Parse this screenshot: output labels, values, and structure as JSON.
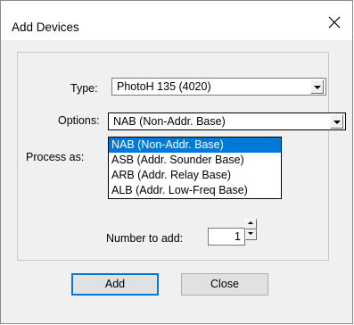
{
  "window": {
    "title": "Add Devices"
  },
  "form": {
    "type_label": "Type:",
    "type_value": "PhotoH 135 (4020)",
    "options_label": "Options:",
    "options_value": "NAB (Non-Addr. Base)",
    "process_label": "Process as:",
    "options_list": [
      "NAB (Non-Addr. Base)",
      "ASB (Addr. Sounder Base)",
      "ARB (Addr. Relay Base)",
      "ALB (Addr. Low-Freq Base)"
    ],
    "number_label": "Number to add:",
    "number_value": "1"
  },
  "buttons": {
    "add": "Add",
    "close": "Close"
  }
}
